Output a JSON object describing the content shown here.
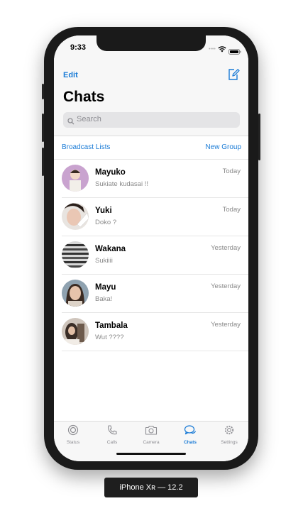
{
  "status_bar": {
    "time": "9:33"
  },
  "header": {
    "edit_label": "Edit",
    "title": "Chats",
    "search_placeholder": "Search"
  },
  "links": {
    "broadcast_label": "Broadcast Lists",
    "new_group_label": "New Group"
  },
  "chats": [
    {
      "name": "Mayuko",
      "message": "Sukiate kudasai !!",
      "time": "Today"
    },
    {
      "name": "Yuki",
      "message": "Doko ?",
      "time": "Today"
    },
    {
      "name": "Wakana",
      "message": "Sukiiii",
      "time": "Yesterday"
    },
    {
      "name": "Mayu",
      "message": "Baka!",
      "time": "Yesterday"
    },
    {
      "name": "Tambala",
      "message": "Wut ????",
      "time": "Yesterday"
    }
  ],
  "tabs": [
    {
      "label": "Status",
      "icon": "status-icon"
    },
    {
      "label": "Calls",
      "icon": "phone-icon"
    },
    {
      "label": "Camera",
      "icon": "camera-icon"
    },
    {
      "label": "Chats",
      "icon": "chat-bubbles-icon",
      "active": true
    },
    {
      "label": "Settings",
      "icon": "gear-icon"
    }
  ],
  "device_caption": "iPhone Xʀ — 12.2",
  "colors": {
    "accent": "#1a7bd6",
    "muted": "#8e8e93"
  }
}
